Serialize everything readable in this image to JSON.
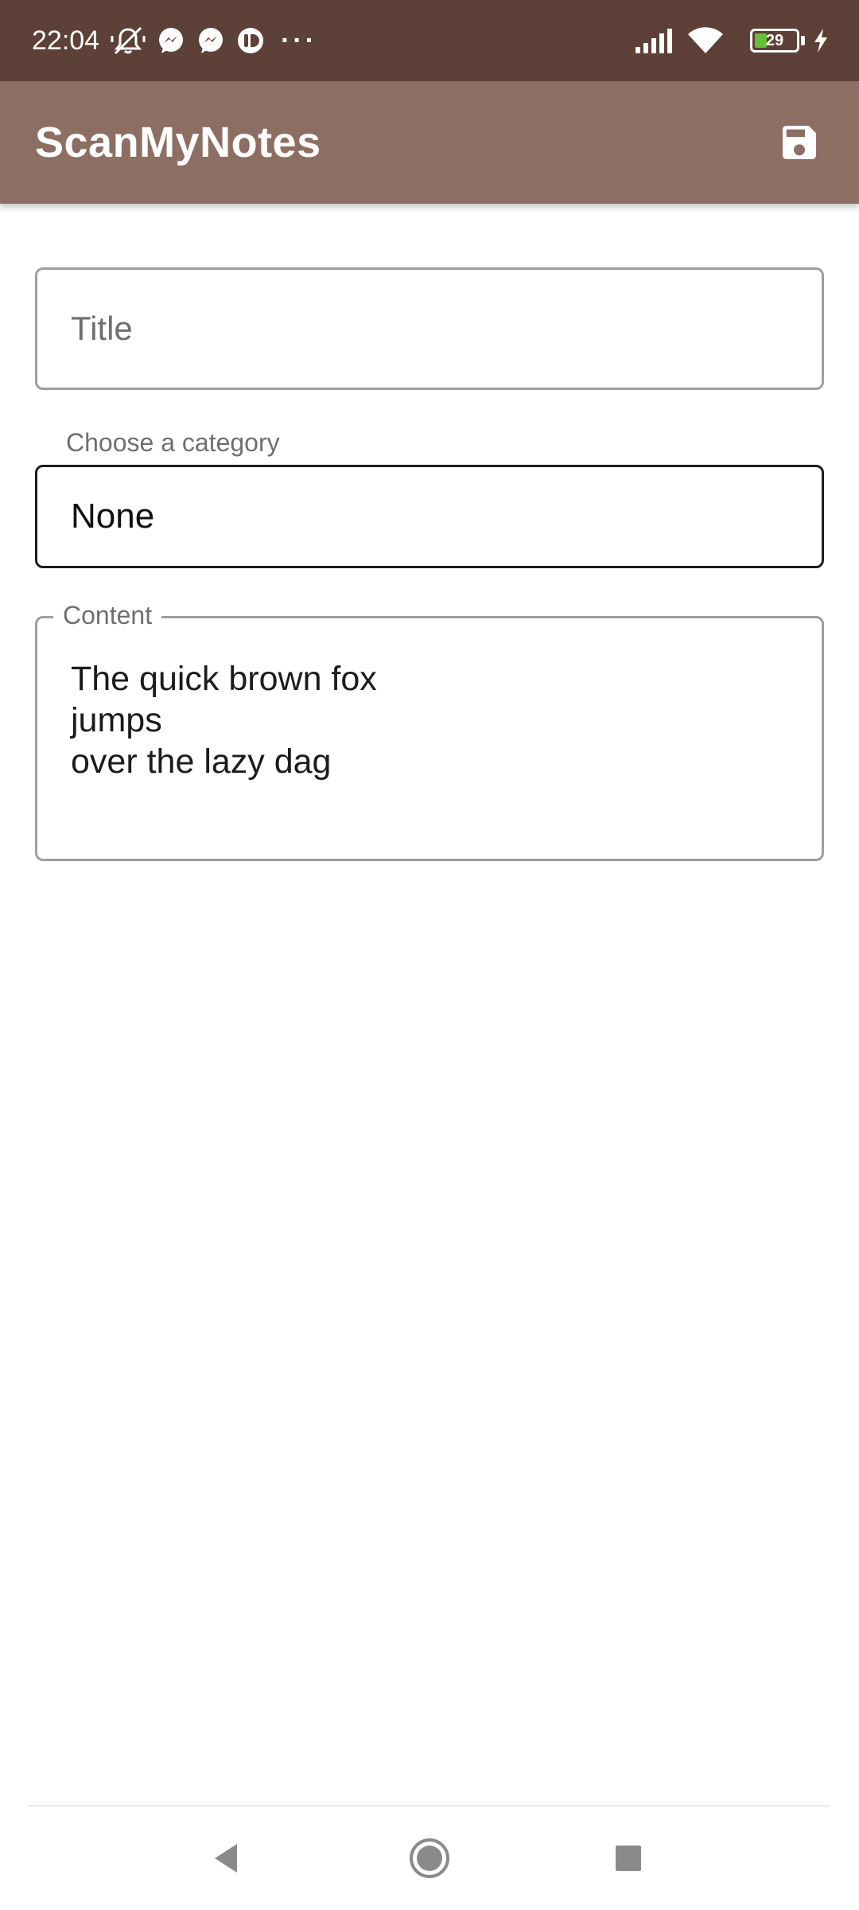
{
  "status_bar": {
    "time": "22:04",
    "battery_level": "29",
    "battery_percent": 29,
    "more_indicator": "···",
    "icons": [
      "mute-icon",
      "messenger-icon",
      "messenger-icon",
      "app-notification-icon",
      "signal-icon",
      "wifi-icon",
      "battery-icon",
      "charging-icon"
    ]
  },
  "app_bar": {
    "title": "ScanMyNotes",
    "save_icon": "save-icon",
    "color": "#8d6e63"
  },
  "form": {
    "title_placeholder": "Title",
    "title_value": "",
    "category_label": "Choose a category",
    "category_value": "None",
    "content_label": "Content",
    "content_value": "The quick brown fox\njumps\nover the lazy dag"
  },
  "nav_bar": {
    "icons": [
      "back-icon",
      "home-icon",
      "recents-icon"
    ]
  },
  "colors": {
    "status_bar": "#5d4037",
    "app_bar": "#8d6e63",
    "battery_fill": "#6abf3a"
  }
}
